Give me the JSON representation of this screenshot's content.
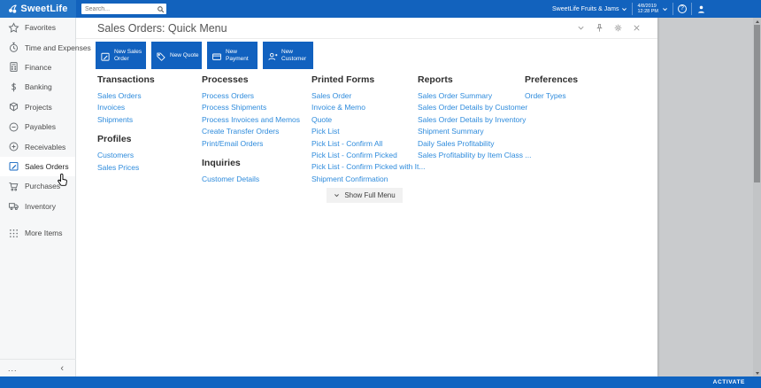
{
  "topbar": {
    "logo_text": "SweetLife",
    "logo_icon": "cherries-icon",
    "search": {
      "placeholder": "Search...",
      "icon": "search-icon"
    },
    "company": "SweetLife Fruits & Jams",
    "date": "4/8/2019",
    "time": "12:28 PM",
    "icons": [
      "chevron-down-icon",
      "help-icon",
      "user-icon"
    ]
  },
  "sidebar": {
    "items": [
      {
        "id": "favorites",
        "label": "Favorites",
        "icon": "star",
        "selected": false
      },
      {
        "id": "time-and-expenses",
        "label": "Time and Expenses",
        "icon": "clock",
        "selected": false
      },
      {
        "id": "finance",
        "label": "Finance",
        "icon": "calculator",
        "selected": false
      },
      {
        "id": "banking",
        "label": "Banking",
        "icon": "dollar",
        "selected": false
      },
      {
        "id": "projects",
        "label": "Projects",
        "icon": "cube",
        "selected": false
      },
      {
        "id": "payables",
        "label": "Payables",
        "icon": "minus-circle",
        "selected": false
      },
      {
        "id": "receivables",
        "label": "Receivables",
        "icon": "plus-circle",
        "selected": false
      },
      {
        "id": "sales-orders",
        "label": "Sales Orders",
        "icon": "edit",
        "selected": true
      },
      {
        "id": "purchases",
        "label": "Purchases",
        "icon": "cart",
        "selected": false
      },
      {
        "id": "inventory",
        "label": "Inventory",
        "icon": "truck",
        "selected": false
      },
      {
        "id": "more-items",
        "label": "More Items",
        "icon": "grid",
        "selected": false,
        "gap_before": true
      }
    ],
    "footer": {
      "ellipsis": "...",
      "collapse": "‹"
    }
  },
  "header": {
    "title": "Sales Orders: Quick Menu",
    "icons": [
      "chevron-down",
      "pin",
      "gear",
      "close"
    ]
  },
  "tiles": [
    {
      "label": "New Sales Order",
      "icon": "edit"
    },
    {
      "label": "New Quote",
      "icon": "tag"
    },
    {
      "label": "New Payment",
      "icon": "card"
    },
    {
      "label": "New Customer",
      "icon": "user-plus"
    }
  ],
  "menu": {
    "columns": [
      {
        "sections": [
          {
            "title": "Transactions",
            "links": [
              "Sales Orders",
              "Invoices",
              "Shipments"
            ]
          },
          {
            "title": "Profiles",
            "links": [
              "Customers",
              "Sales Prices"
            ]
          }
        ]
      },
      {
        "sections": [
          {
            "title": "Processes",
            "links": [
              "Process Orders",
              "Process Shipments",
              "Process Invoices and Memos",
              "Create Transfer Orders",
              "Print/Email Orders"
            ]
          },
          {
            "title": "Inquiries",
            "links": [
              "Customer Details"
            ]
          }
        ]
      },
      {
        "sections": [
          {
            "title": "Printed Forms",
            "links": [
              "Sales Order",
              "Invoice & Memo",
              "Quote",
              "Pick List",
              "Pick List - Confirm All",
              "Pick List - Confirm Picked",
              "Pick List - Confirm Picked with It...",
              "Shipment Confirmation"
            ]
          }
        ]
      },
      {
        "sections": [
          {
            "title": "Reports",
            "links": [
              "Sales Order Summary",
              "Sales Order Details by Customer",
              "Sales Order Details by Inventory",
              "Shipment Summary",
              "Daily Sales Profitability",
              "Sales Profitability by Item Class ..."
            ]
          }
        ]
      },
      {
        "sections": [
          {
            "title": "Preferences",
            "links": [
              "Order Types"
            ]
          }
        ]
      }
    ]
  },
  "show_full_menu_label": "Show Full Menu",
  "footer": {
    "activate_label": "ACTIVATE"
  },
  "colors": {
    "topbar_blue": "#1262bd",
    "tile_blue": "#1161bf",
    "link_blue": "#2e8bdc",
    "bottombar_blue": "#1064c1"
  }
}
